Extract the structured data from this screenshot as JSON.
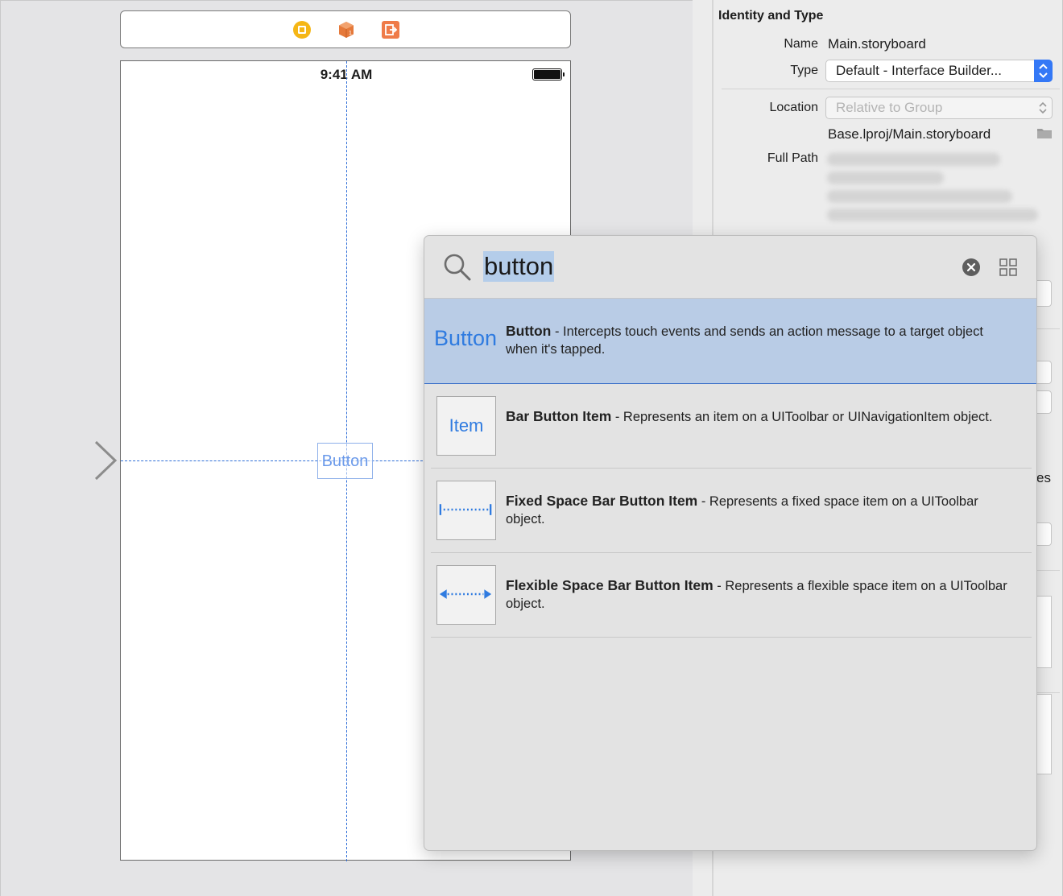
{
  "canvas": {
    "status_time": "9:41 AM",
    "placed_button_label": "Button"
  },
  "inspector": {
    "section_title": "Identity and Type",
    "name_label": "Name",
    "name_value": "Main.storyboard",
    "type_label": "Type",
    "type_value": "Default - Interface Builder...",
    "location_label": "Location",
    "location_value": "Relative to Group",
    "location_path": "Base.lproj/Main.storyboard",
    "full_path_label": "Full Path",
    "partial_text": "es"
  },
  "library": {
    "search_value": "button",
    "items": [
      {
        "thumb_text": "Button",
        "title": "Button",
        "description": " - Intercepts touch events and sends an action message to a target object when it's tapped.",
        "selected": true
      },
      {
        "thumb_text": "Item",
        "title": "Bar Button Item",
        "description": " - Represents an item on a UIToolbar or UINavigationItem object.",
        "selected": false
      },
      {
        "thumb_icon": "fixed-space-icon",
        "title": "Fixed Space Bar Button Item",
        "description": " - Represents a fixed space item on a UIToolbar object.",
        "selected": false
      },
      {
        "thumb_icon": "flexible-space-icon",
        "title": "Flexible Space Bar Button Item",
        "description": " - Represents a flexible space item on a UIToolbar object.",
        "selected": false
      }
    ]
  },
  "colors": {
    "accent": "#3478f6",
    "selection": "#b9cce6",
    "link_blue": "#2f7be0",
    "guide": "#2f6ed8"
  }
}
